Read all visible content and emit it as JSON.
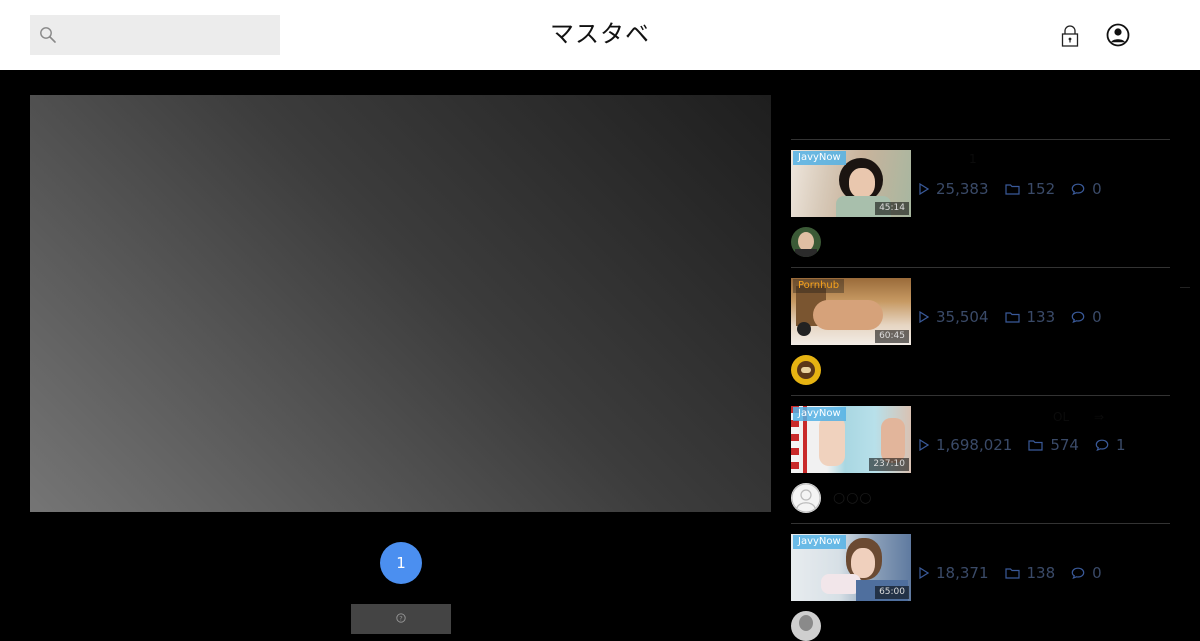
{
  "header": {
    "logo": "マスタベ",
    "search": {
      "placeholder": ""
    }
  },
  "player": {
    "state": "loading"
  },
  "pagination": {
    "current": "1"
  },
  "sidebar": {
    "videos": [
      {
        "source": "JavyNow",
        "duration": "45:14",
        "views": "25,383",
        "favorites": "152",
        "comments": "0",
        "username": ""
      },
      {
        "source": "Pornhub",
        "duration": "60:45",
        "views": "35,504",
        "favorites": "133",
        "comments": "0",
        "username": ""
      },
      {
        "source": "JavyNow",
        "duration": "237:10",
        "views": "1,698,021",
        "favorites": "574",
        "comments": "1",
        "username": "○○○"
      },
      {
        "source": "JavyNow",
        "duration": "65:00",
        "views": "18,371",
        "favorites": "138",
        "comments": "0",
        "username": ""
      }
    ]
  },
  "colors": {
    "accent": "#4b8ff0",
    "background": "#000000",
    "header": "#ffffff",
    "stat_text": "#3a4a68"
  }
}
